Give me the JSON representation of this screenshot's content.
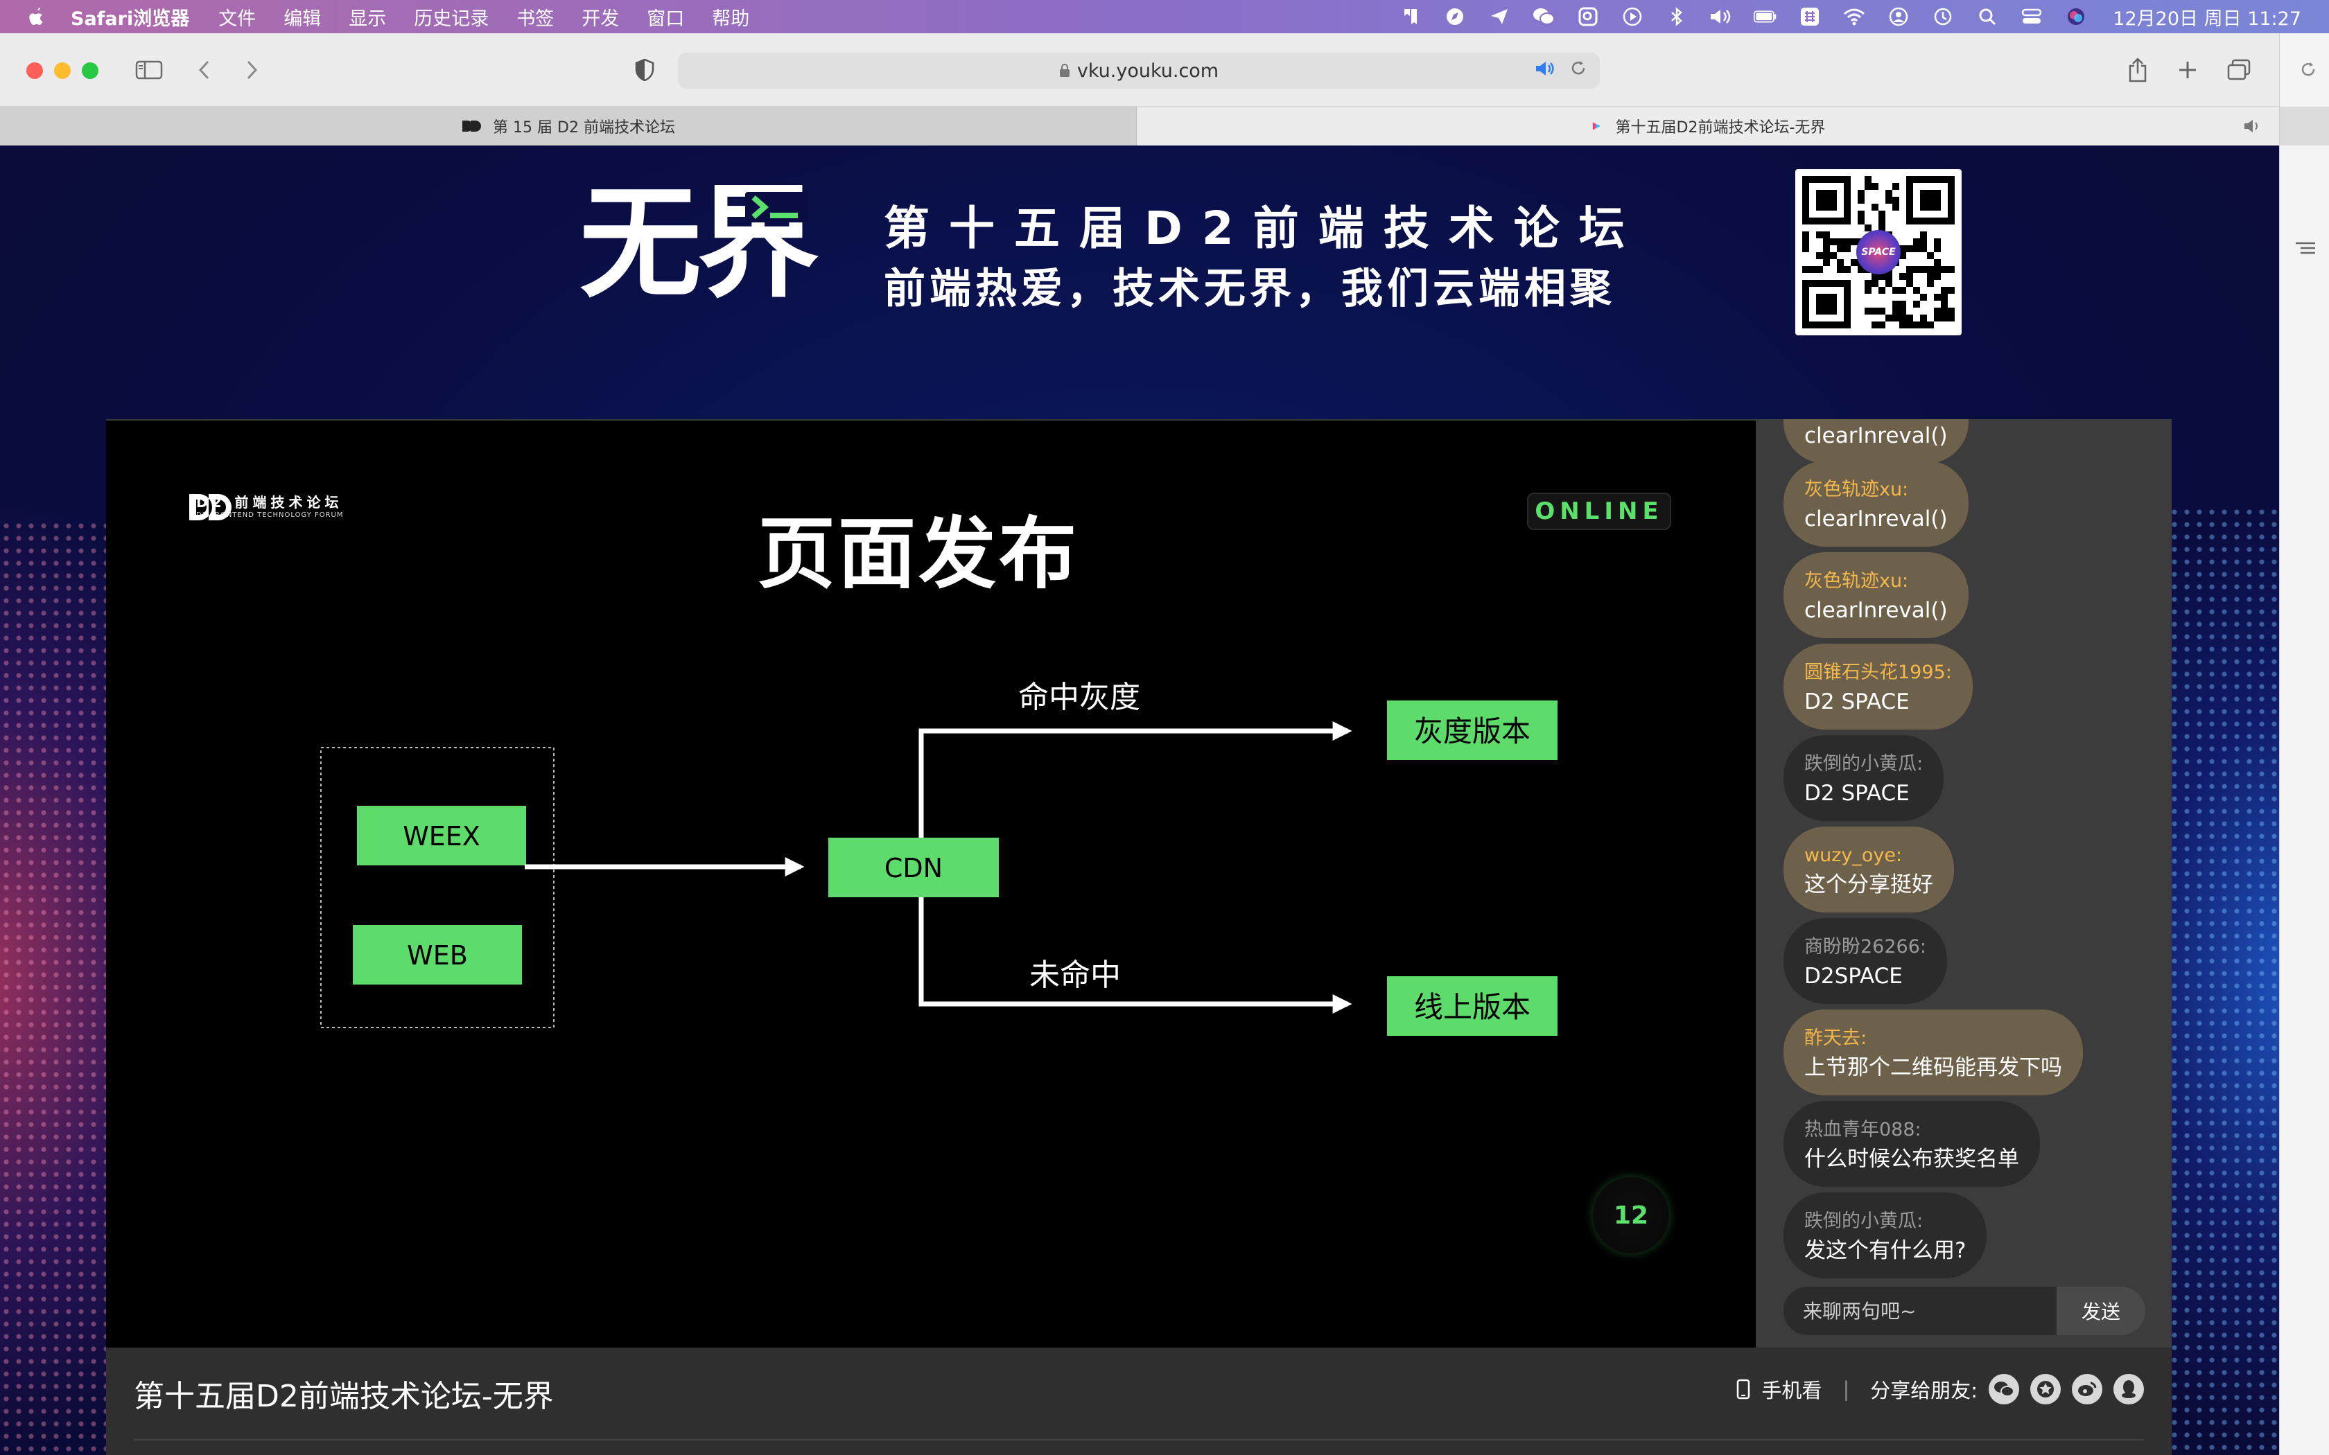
{
  "menubar": {
    "app_name": "Safari浏览器",
    "menus": [
      "文件",
      "编辑",
      "显示",
      "历史记录",
      "书签",
      "开发",
      "窗口",
      "帮助"
    ],
    "clock": "12月20日 周日  11:27"
  },
  "browser": {
    "url": "vku.youku.com",
    "tabs": [
      {
        "label": "第 15 届 D2 前端技术论坛"
      },
      {
        "label": "第十五届D2前端技术论坛-无界"
      }
    ]
  },
  "banner": {
    "logo_text": "无界",
    "line1": "第十五届D2前端技术论坛",
    "line2": "前端热爱，技术无界，我们云端相聚",
    "qr_center_label": "SPACE"
  },
  "slide": {
    "brand_title": "D2 前端技术论坛",
    "brand_subtitle": "D2 FRONTEND TECHNOLOGY FORUM",
    "title": "页面发布",
    "badge": "ONLINE",
    "page_number": "12",
    "diagram": {
      "source_nodes": [
        "WEEX",
        "WEB"
      ],
      "hub_node": "CDN",
      "branch_hit_label": "命中灰度",
      "branch_miss_label": "未命中",
      "target_gray": "灰度版本",
      "target_online": "线上版本",
      "node_color": "#5ddc6c"
    }
  },
  "chat": {
    "top_partial_message": "clearInreval()",
    "messages": [
      {
        "user": "灰色轨迹xu:",
        "text": "clearInreval()",
        "style": "gold"
      },
      {
        "user": "灰色轨迹xu:",
        "text": "clearInreval()",
        "style": "gold"
      },
      {
        "user": "圆锥石头花1995:",
        "text": "D2 SPACE",
        "style": "gold"
      },
      {
        "user": "跌倒的小黄瓜:",
        "text": "D2 SPACE",
        "style": "dark"
      },
      {
        "user": "wuzy_oye:",
        "text": "这个分享挺好",
        "style": "gold"
      },
      {
        "user": "商盼盼26266:",
        "text": "D2SPACE",
        "style": "dark"
      },
      {
        "user": "酢天去:",
        "text": "上节那个二维码能再发下吗",
        "style": "gold"
      },
      {
        "user": "热血青年088:",
        "text": "什么时候公布获奖名单",
        "style": "dark"
      },
      {
        "user": "跌倒的小黄瓜:",
        "text": "发这个有什么用?",
        "style": "dark"
      }
    ],
    "input_placeholder": "来聊两句吧~",
    "send_label": "发送"
  },
  "info": {
    "video_title": "第十五届D2前端技术论坛-无界",
    "mobile_label": "手机看",
    "separator": "|",
    "share_label": "分享给朋友:",
    "share_icons": [
      "wechat-icon",
      "star-icon",
      "weibo-icon",
      "qq-icon"
    ]
  },
  "colors": {
    "accent_green": "#5be06c",
    "chat_gold_user": "#f4b84b",
    "page_bg": "#0a0d42"
  }
}
